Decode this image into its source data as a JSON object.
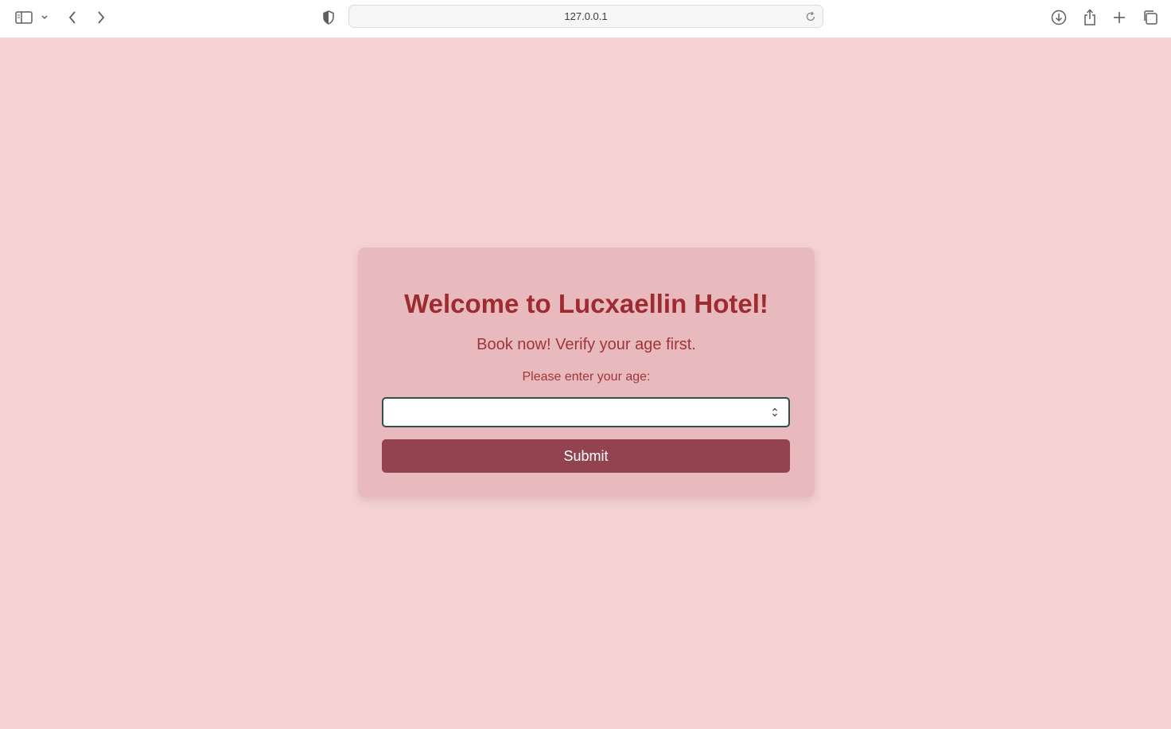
{
  "browser": {
    "url": "127.0.0.1",
    "icons": {
      "sidebar": "sidebar-icon",
      "sidebar_menu": "chevron-down-icon",
      "back": "back-arrow-icon",
      "forward": "forward-arrow-icon",
      "privacy": "shield-icon",
      "reload": "reload-icon",
      "downloads": "download-icon",
      "share": "share-icon",
      "new_tab": "plus-icon",
      "tab_overview": "tabs-icon"
    }
  },
  "card": {
    "title": "Welcome to Lucxaellin Hotel!",
    "subtitle": "Book now! Verify your age first.",
    "age_label": "Please enter your age:",
    "age_value": "",
    "submit_label": "Submit"
  },
  "colors": {
    "page_background": "#f4d2d4",
    "card_background": "#e8babd",
    "title_color": "#9e2b30",
    "button_background": "#934250",
    "input_border": "#2f4f48"
  }
}
